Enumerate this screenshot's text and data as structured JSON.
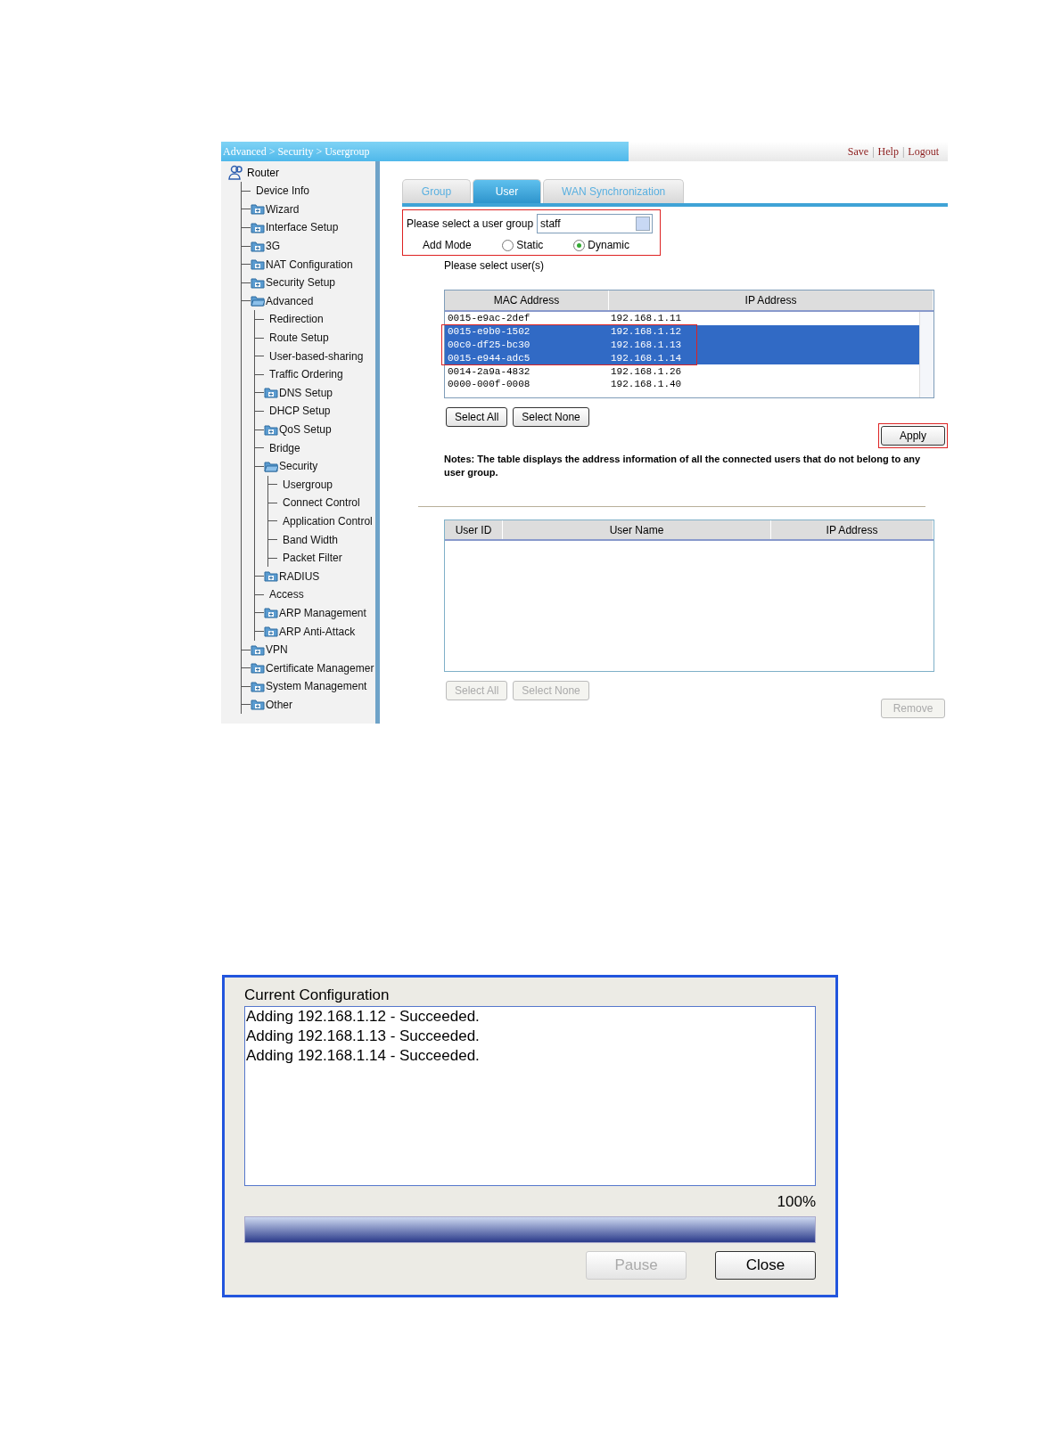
{
  "breadcrumb": "Advanced > Security > Usergroup",
  "header_links": [
    "Save",
    "Help",
    "Logout"
  ],
  "header_separator": "|",
  "sidebar": {
    "root": "Router",
    "items": [
      {
        "label": "Device Info",
        "kind": "page"
      },
      {
        "label": "Wizard",
        "kind": "folder",
        "expanded": false
      },
      {
        "label": "Interface Setup",
        "kind": "folder",
        "expanded": false
      },
      {
        "label": "3G",
        "kind": "folder",
        "expanded": false
      },
      {
        "label": "NAT Configuration",
        "kind": "folder",
        "expanded": false
      },
      {
        "label": "Security Setup",
        "kind": "folder",
        "expanded": false
      },
      {
        "label": "Advanced",
        "kind": "folder",
        "expanded": true,
        "children": [
          {
            "label": "Redirection",
            "kind": "page"
          },
          {
            "label": "Route Setup",
            "kind": "page"
          },
          {
            "label": "User-based-sharing",
            "kind": "page"
          },
          {
            "label": "Traffic Ordering",
            "kind": "page"
          },
          {
            "label": "DNS Setup",
            "kind": "folder",
            "expanded": false
          },
          {
            "label": "DHCP Setup",
            "kind": "page"
          },
          {
            "label": "QoS Setup",
            "kind": "folder",
            "expanded": false
          },
          {
            "label": "Bridge",
            "kind": "page"
          },
          {
            "label": "Security",
            "kind": "folder",
            "expanded": true,
            "children": [
              {
                "label": "Usergroup",
                "kind": "page"
              },
              {
                "label": "Connect Control",
                "kind": "page"
              },
              {
                "label": "Application Control",
                "kind": "page"
              },
              {
                "label": "Band Width",
                "kind": "page"
              },
              {
                "label": "Packet Filter",
                "kind": "page"
              }
            ]
          },
          {
            "label": "RADIUS",
            "kind": "folder",
            "expanded": false
          },
          {
            "label": "Access",
            "kind": "page"
          },
          {
            "label": "ARP Management",
            "kind": "folder",
            "expanded": false
          },
          {
            "label": "ARP Anti-Attack",
            "kind": "folder",
            "expanded": false
          }
        ]
      },
      {
        "label": "VPN",
        "kind": "folder",
        "expanded": false
      },
      {
        "label": "Certificate Managemer",
        "kind": "folder",
        "expanded": false
      },
      {
        "label": "System Management",
        "kind": "folder",
        "expanded": false
      },
      {
        "label": "Other",
        "kind": "folder",
        "expanded": false
      }
    ]
  },
  "tabs": [
    {
      "label": "Group",
      "selected": false
    },
    {
      "label": "User",
      "selected": true
    },
    {
      "label": "WAN Synchronization",
      "selected": false
    }
  ],
  "user_group": {
    "label": "Please select a user group",
    "value": "staff"
  },
  "add_mode": {
    "label": "Add Mode",
    "options": [
      {
        "label": "Static",
        "selected": false
      },
      {
        "label": "Dynamic",
        "selected": true
      }
    ]
  },
  "select_users_label": "Please select user(s)",
  "user_table": {
    "columns": [
      "MAC Address",
      "IP Address"
    ],
    "rows": [
      {
        "mac": "0015-e9ac-2def",
        "ip": "192.168.1.11",
        "selected": false
      },
      {
        "mac": "0015-e9b0-1502",
        "ip": "192.168.1.12",
        "selected": true
      },
      {
        "mac": "00c0-df25-bc30",
        "ip": "192.168.1.13",
        "selected": true
      },
      {
        "mac": "0015-e944-adc5",
        "ip": "192.168.1.14",
        "selected": true
      },
      {
        "mac": "0014-2a9a-4832",
        "ip": "192.168.1.26",
        "selected": false
      },
      {
        "mac": "0000-000f-0008",
        "ip": "192.168.1.40",
        "selected": false
      }
    ]
  },
  "table_buttons": [
    {
      "label": "Select All",
      "disabled": false
    },
    {
      "label": "Select None",
      "disabled": false
    }
  ],
  "apply_button": "Apply",
  "notes": "Notes: The table displays the address information of all the connected users that do not belong to any user group.",
  "group_table": {
    "columns": [
      "User ID",
      "User Name",
      "IP Address"
    ]
  },
  "group_buttons": [
    {
      "label": "Select All",
      "disabled": true
    },
    {
      "label": "Select None",
      "disabled": true
    }
  ],
  "remove_button": {
    "label": "Remove",
    "disabled": true
  },
  "dialog": {
    "title": "Current Configuration",
    "log": [
      "Adding 192.168.1.12 - Succeeded.",
      "Adding 192.168.1.13 - Succeeded.",
      "Adding 192.168.1.14 - Succeeded."
    ],
    "percent": "100%",
    "progress": {
      "level": 1
    },
    "buttons": [
      {
        "label": "Pause",
        "disabled": true
      },
      {
        "label": "Close",
        "disabled": false
      }
    ]
  }
}
